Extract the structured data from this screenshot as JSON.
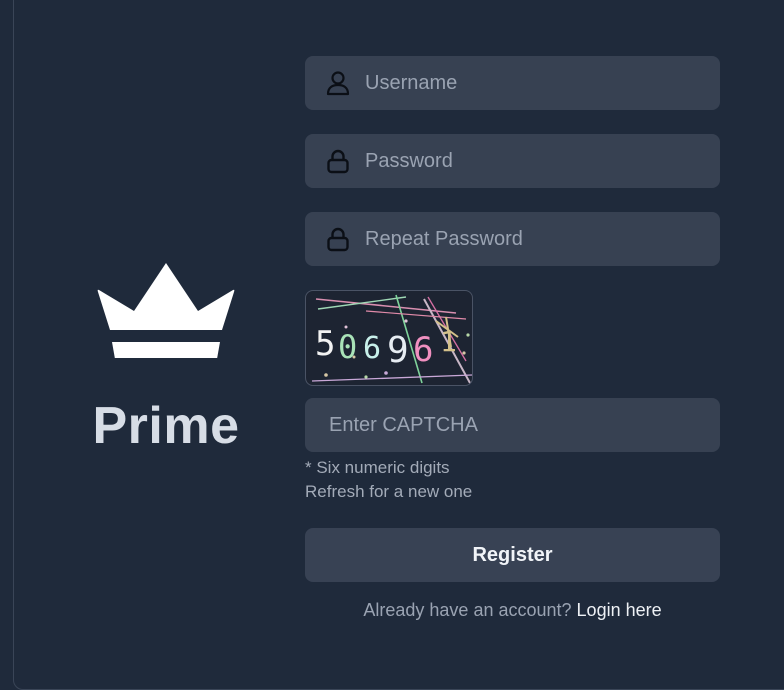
{
  "brand": {
    "name": "Prime",
    "logo_icon": "crown-icon"
  },
  "form": {
    "username": {
      "placeholder": "Username",
      "value": "",
      "icon": "user-icon"
    },
    "password": {
      "placeholder": "Password",
      "value": "",
      "icon": "lock-icon"
    },
    "repeat_password": {
      "placeholder": "Repeat Password",
      "value": "",
      "icon": "lock-icon"
    },
    "captcha_image": {
      "digits": [
        "5",
        "0",
        "6",
        "9",
        "6",
        "1"
      ]
    },
    "captcha_input": {
      "placeholder": "Enter CAPTCHA",
      "value": ""
    },
    "hints": [
      "* Six numeric digits",
      "Refresh for a new one"
    ],
    "register_label": "Register",
    "login_prompt": "Already have an account?",
    "login_link": "Login here"
  },
  "colors": {
    "background": "#1f2a3b",
    "field": "#374152",
    "text": "#d7dde6",
    "muted": "#9aa3b2"
  }
}
